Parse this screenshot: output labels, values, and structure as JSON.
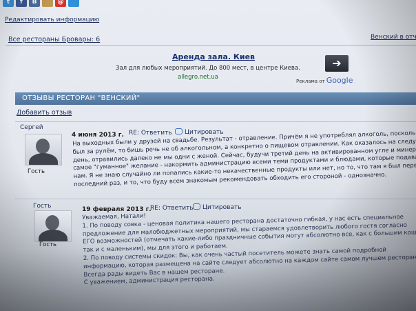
{
  "social": [
    {
      "label": "t",
      "color": "#3b8fd6",
      "icon": "twitter-icon"
    },
    {
      "label": "f",
      "color": "#3b5998",
      "icon": "facebook-icon"
    },
    {
      "label": "B",
      "color": "#4a6f9c",
      "icon": "vkontakte-icon"
    },
    {
      "label": "",
      "color": "#c09a55",
      "icon": "bookmark-icon"
    },
    {
      "label": "@",
      "color": "#d9342b",
      "icon": "mail-icon"
    },
    {
      "label": "",
      "color": "#2f8fd9",
      "icon": "share-icon"
    }
  ],
  "header": {
    "edit_link": "Редактировать информацию",
    "all_restaurants": "Все рестораны Бровары: 6",
    "vensky_link": "Венский в отчёт"
  },
  "ad": {
    "title": "Аренда зала. Киев",
    "desc": "Зал для любых мероприятий. До 800 мест, в центре Киева.",
    "url": "allegro.net.ua",
    "arrow": "➔",
    "ads_by": "Реклама от",
    "google": "Google"
  },
  "reviews": {
    "section_title": "ОТЗЫВЫ РЕСТОРАН \"ВЕНСКИЙ\"",
    "add_link": "Добавить отзыв",
    "items": [
      {
        "author": "Сергей",
        "role": "Гость",
        "date": "4 июня 2013 г.",
        "reply": "RE: Ответить",
        "quote": "Цитировать",
        "lines": [
          "На выходных были у друзей на свадьбе. Результат - отравление. Причём я не употреблял алкоголь, поскольку",
          "был за рулём, то бишь речь не об алкогольном, а конкретно о пищевом отравлении. Как оказалось на следующий",
          "день, отравились далеко не мы одни с женой. Сейчас, будучи третий день на активированном угле и минералке,",
          "самое \"гуманное\" желание - накормить администрацию всеми теми продуктами и блюдами, которые подавали",
          "нам. Я не знаю случайно ли попались какие-то некачественные продукты или нет, но то, что там я был первый и",
          "последний раз, и то, что буду всем знакомым рекомендовать обходить его стороной - однозначно."
        ]
      },
      {
        "author": "Гость",
        "role": "Гость",
        "date": "19 февраля 2013 г.",
        "reply": "RE: Ответить",
        "quote": "Цитировать",
        "lines": [
          "Уважаемая, Натали!",
          "1. По поводу совка - ценовая политика нашего ресторана достаточно гибкая, у нас есть специальное",
          "предложение для малобюджетных мероприятий, мы стараемся удовлетворить любого гостя согласно",
          "ЕГО возможностей (отмечать какие-либо праздничные события могут абсолютно все, как с большим кошельком,",
          "так и с маленьким), мы для этого и работаем.",
          "2. По поводу системы скидок: Вы, как очень частый посетитель можете знать самой подробной",
          "информацию, которая размещена на сайте следует абсолютно на каждом сайте самом лучшем ресторана.",
          "Всегда рады видеть Вас в нашем ресторане.",
          "С уважением, администрация ресторана."
        ]
      }
    ]
  }
}
